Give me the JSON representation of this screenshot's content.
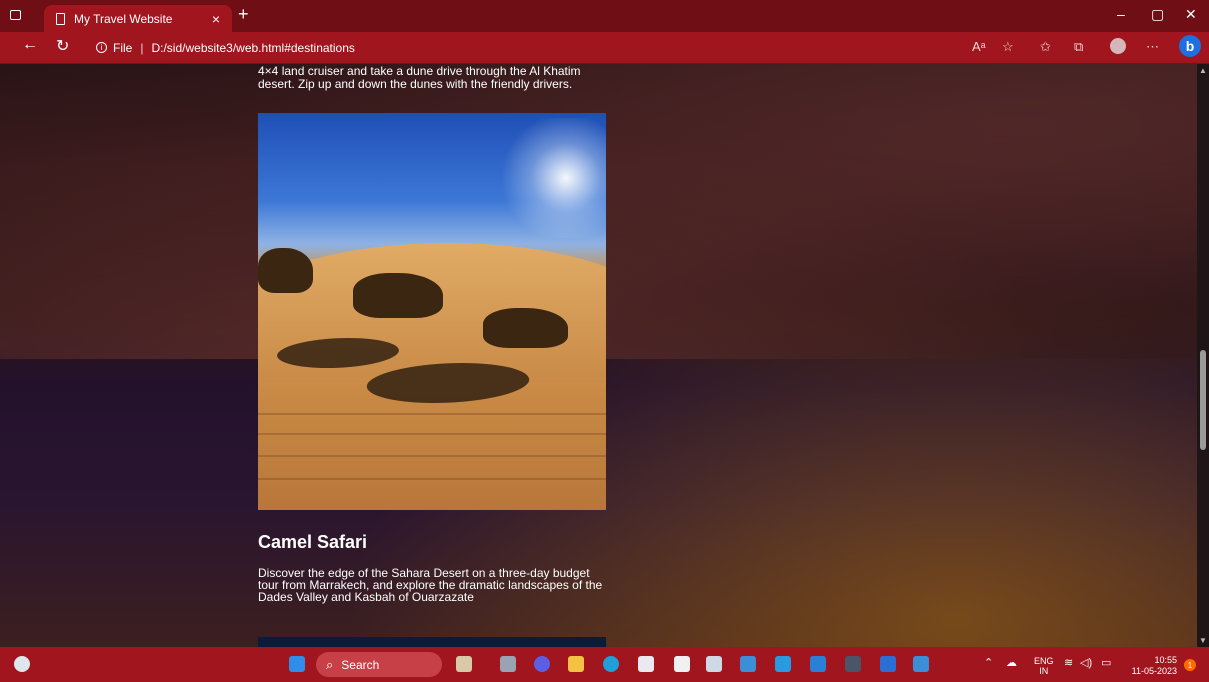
{
  "browser": {
    "tab_title": "My Travel Website",
    "tab_close": "×",
    "new_tab": "+",
    "url_info": "i",
    "url_file_label": "File",
    "url_separator": "|",
    "url": "D:/sid/website3/web.html#destinations",
    "window_minimize": "–",
    "window_restore": "▢",
    "window_close": "✕",
    "bing_label": "b"
  },
  "page": {
    "previous_card_text": "4×4 land cruiser and take a dune drive through the Al Khatim desert. Zip up and down the dunes with the friendly drivers.",
    "card": {
      "title": "Camel Safari",
      "description": "Discover the edge of the Sahara Desert on a three-day budget tour from Marrakech, and explore the dramatic landscapes of the Dades Valley and Kasbah of Ouarzazate"
    }
  },
  "taskbar": {
    "search_label": "Search",
    "language_line1": "ENG",
    "language_line2": "IN",
    "time": "10:55",
    "date": "11-05-2023",
    "notification_count": "1"
  },
  "colors": {
    "browser_accent": "#a0151e",
    "tabbar_bg": "#6f0e14"
  }
}
